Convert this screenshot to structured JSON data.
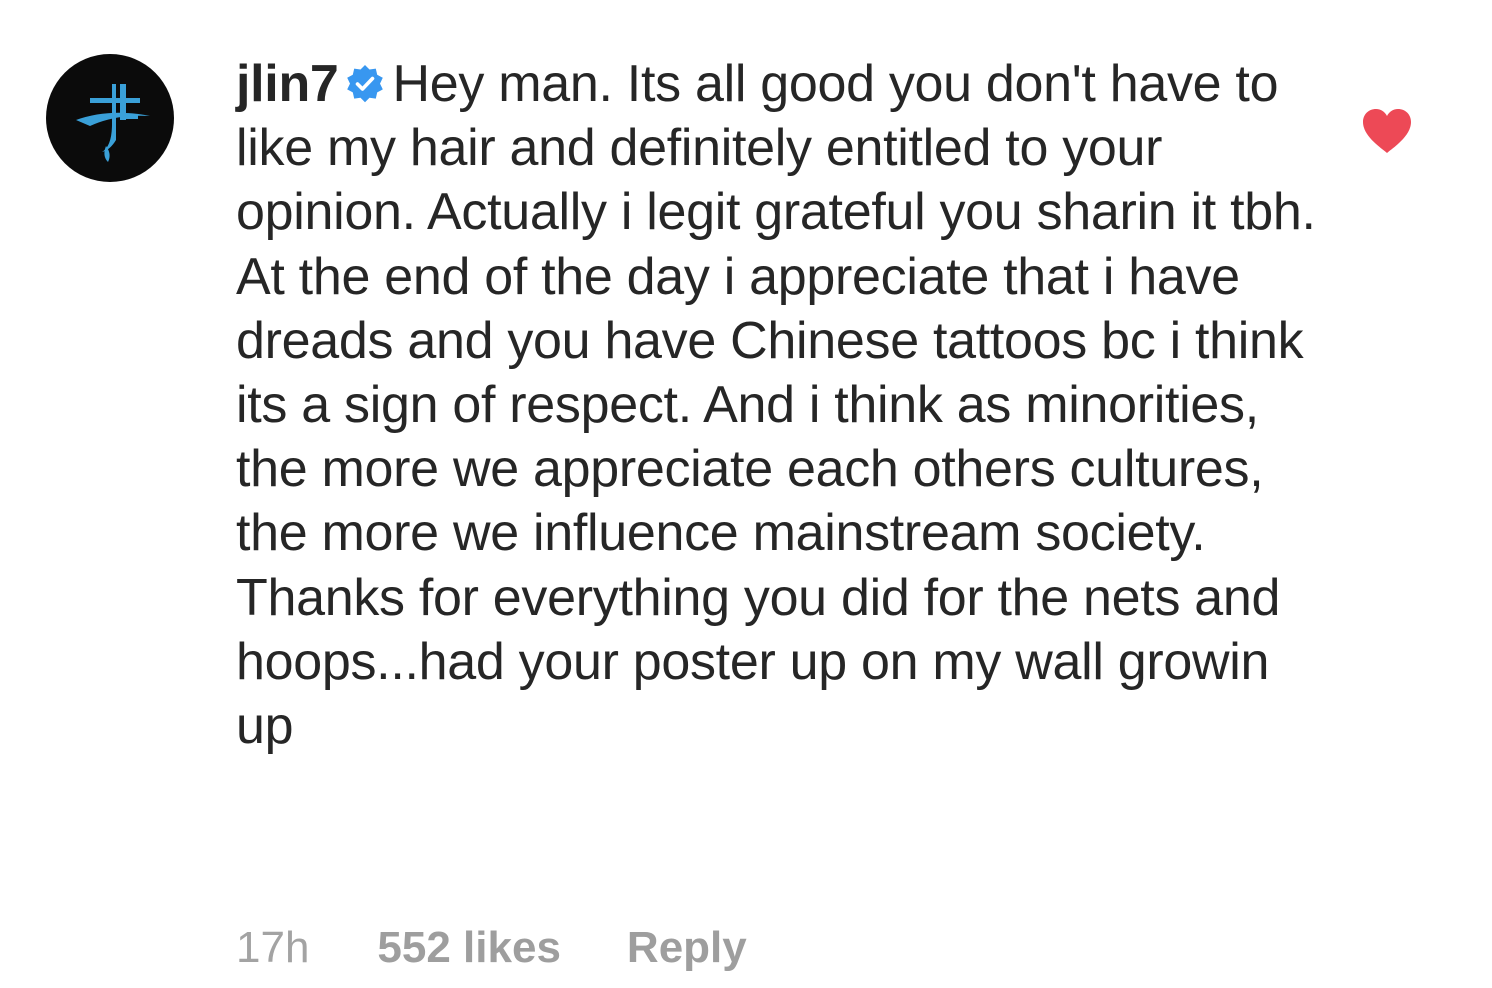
{
  "comment": {
    "avatar_icon": "jl-logo-icon",
    "username": "jlin7",
    "verified_icon": "verified-badge-icon",
    "text": "Hey man. Its all good you don't have to like my hair and definitely entitled to your opinion. Actually i legit grateful you sharin it tbh. At the end of the day i appreciate that i have dreads and you have Chinese tattoos bc i think its a sign of respect. And i think as minorities, the more we appreciate each others cultures, the more we influence mainstream society. Thanks for everything you did for the nets and hoops...had your poster up on my wall growin up",
    "time": "17h",
    "likes": "552 likes",
    "reply_label": "Reply",
    "liked": true,
    "like_icon": "heart-filled-icon"
  },
  "colors": {
    "text": "#262626",
    "meta": "#a3a3a3",
    "heart": "#ed4956",
    "verified": "#3897f0",
    "avatar_bg": "#0b0b0b",
    "logo": "#3aa0d8"
  }
}
